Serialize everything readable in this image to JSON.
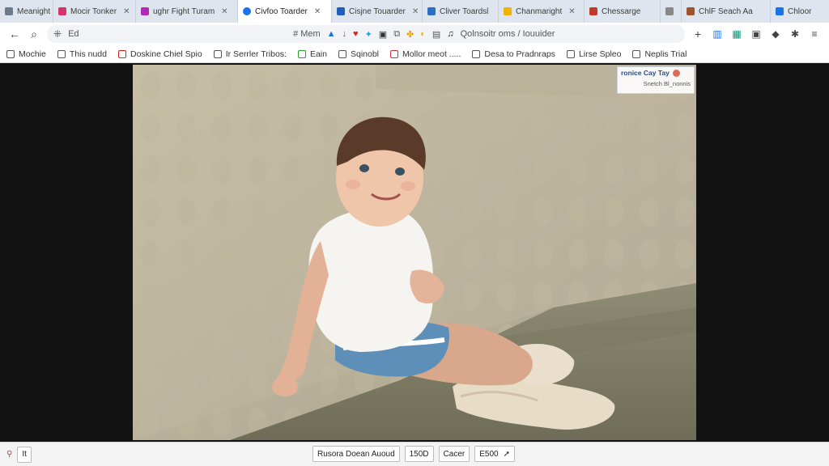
{
  "tabs": [
    {
      "label": "Meanight",
      "color": "#6c7a89",
      "close": "˅",
      "active": false
    },
    {
      "label": "Mocir Tonker",
      "color": "#d6336c",
      "close": "✕",
      "active": false
    },
    {
      "label": "ughr Fight Turam",
      "color": "#b02ab5",
      "close": "✕",
      "active": false
    },
    {
      "label": "Civfoo Toarder",
      "color": "#1a73e8",
      "close": "✕",
      "active": true
    },
    {
      "label": "Cisjne Touarder",
      "color": "#1f5fbf",
      "close": "✕",
      "active": false
    },
    {
      "label": "Cliver Toardsl",
      "color": "#2b6fc2",
      "close": "",
      "active": false
    },
    {
      "label": "Chanmaright",
      "color": "#f0b400",
      "close": "✕",
      "active": false
    },
    {
      "label": "Chessarge",
      "color": "#c0392b",
      "close": "",
      "active": false
    },
    {
      "label": "",
      "color": "#888888",
      "close": "",
      "active": false
    },
    {
      "label": "ChlF Seach Aa",
      "color": "#a0522d",
      "close": "",
      "active": false
    },
    {
      "label": "Chloor",
      "color": "#1a73e8",
      "close": "",
      "active": false
    }
  ],
  "toolbar": {
    "back": "←",
    "search": "⌕",
    "apps": "⁜",
    "address_left": "Ed",
    "mem_label": "Mem",
    "address_text": "Qolnsoitr oms / Iouuider",
    "add": "+"
  },
  "bookmarks": [
    {
      "label": "Mochie"
    },
    {
      "label": "This nudd"
    },
    {
      "label": "Doskine Chiel Spio"
    },
    {
      "label": "Ir Serrler Tribos:"
    },
    {
      "label": "Eain"
    },
    {
      "label": "Sqinobl"
    },
    {
      "label": "Mollor meot ....."
    },
    {
      "label": "Desa to Pradnraps"
    },
    {
      "label": "Lirse Spleo"
    },
    {
      "label": "Neplis Trial"
    }
  ],
  "photo": {
    "watermark_title": "ronice Cay Tay",
    "watermark_sub": "Snetch Bl_nonnis"
  },
  "statusbar": {
    "left_label": "It",
    "items": [
      "Rusora Doean Auoud",
      "150D",
      "Cacer",
      "E500"
    ]
  },
  "colors": {
    "tab_bar": "#dfe5ee",
    "active_tab": "#ffffff",
    "viewport_bg": "#121212"
  }
}
